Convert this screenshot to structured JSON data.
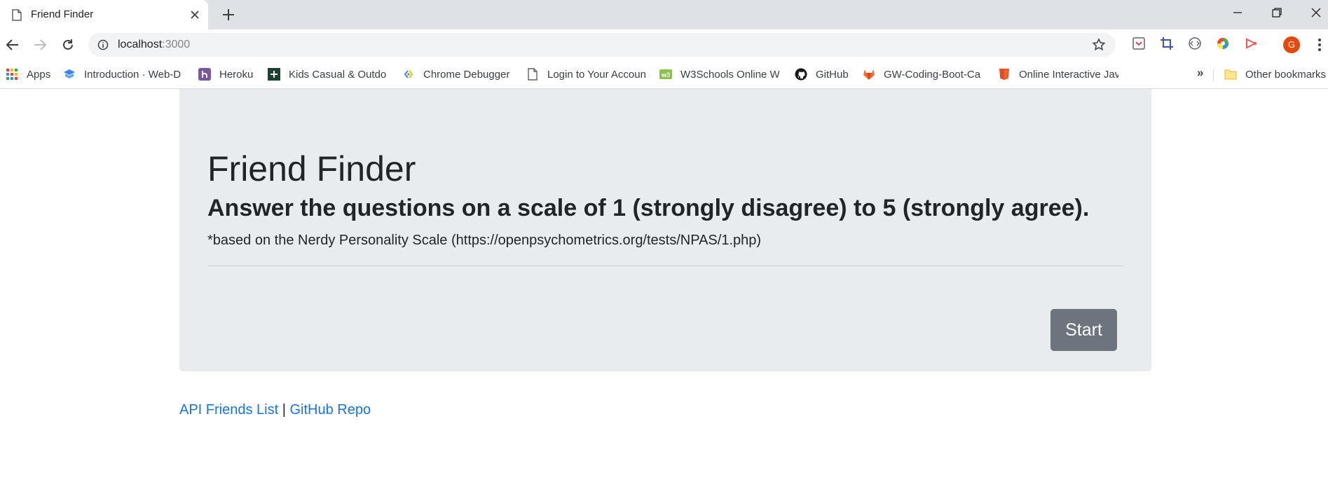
{
  "browser": {
    "tab_title": "Friend Finder",
    "url_host": "localhost",
    "url_port": ":3000",
    "avatar_letter": "G",
    "bookmarks": [
      {
        "label": "Apps",
        "icon": "apps-grid-icon"
      },
      {
        "label": "Introduction · Web-D",
        "icon": "book-icon"
      },
      {
        "label": "Heroku",
        "icon": "heroku-icon"
      },
      {
        "label": "Kids Casual & Outdo",
        "icon": "plus-square-icon"
      },
      {
        "label": "Chrome Debugger",
        "icon": "chrome-debugger-icon"
      },
      {
        "label": "Login to Your Accoun",
        "icon": "page-icon"
      },
      {
        "label": "W3Schools Online W",
        "icon": "w3schools-icon"
      },
      {
        "label": "GitHub",
        "icon": "github-icon"
      },
      {
        "label": "GW-Coding-Boot-Ca",
        "icon": "gitlab-icon"
      },
      {
        "label": "Online Interactive Jav",
        "icon": "html5-icon"
      }
    ],
    "more_label": "»",
    "other_bookmarks": "Other bookmarks"
  },
  "page": {
    "title": "Friend Finder",
    "subtitle": "Answer the questions on a scale of 1 (strongly disagree) to 5 (strongly agree).",
    "note": "*based on the Nerdy Personality Scale (https://openpsychometrics.org/tests/NPAS/1.php)",
    "start_label": "Start",
    "footer": {
      "api_link": "API Friends List",
      "separator": "|",
      "repo_link": "GitHub Repo"
    }
  },
  "colors": {
    "jumbotron_bg": "#e9ecef",
    "button_bg": "#6c757d",
    "link": "#1a73e8",
    "avatar": "#e8470b"
  }
}
